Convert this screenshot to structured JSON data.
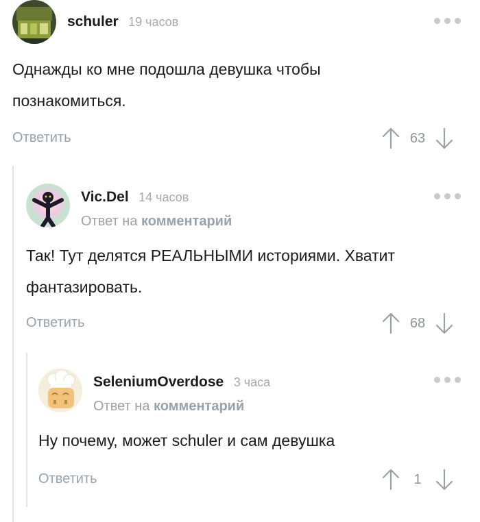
{
  "comments": [
    {
      "author": "schuler",
      "time": "19 часов",
      "body_lines": [
        "Однажды ко мне подошла девушка чтобы",
        "познакомиться."
      ],
      "reply_label": "Ответить",
      "rating": "63",
      "avatar_icon": "avatar-machine-icon"
    },
    {
      "author": "Vic.Del",
      "time": "14 часов",
      "reply_prefix": "Ответ на",
      "reply_link": "комментарий",
      "body_lines": [
        "Так! Тут делятся РЕАЛЬНЫМИ историями. Хватит",
        "фантазировать."
      ],
      "reply_label": "Ответить",
      "rating": "68",
      "avatar_icon": "avatar-figure-icon"
    },
    {
      "author": "SeleniumOverdose",
      "time": "3 часа",
      "reply_prefix": "Ответ на",
      "reply_link": "комментарий",
      "body_lines": [
        "Ну почему, может schuler и сам девушка"
      ],
      "reply_label": "Ответить",
      "rating": "1",
      "avatar_icon": "avatar-chef-icon"
    }
  ],
  "colors": {
    "text": "#1c1c1e",
    "muted": "#a8a8ac",
    "link": "#97a2ab",
    "thread_line": "#dfe1e4"
  }
}
